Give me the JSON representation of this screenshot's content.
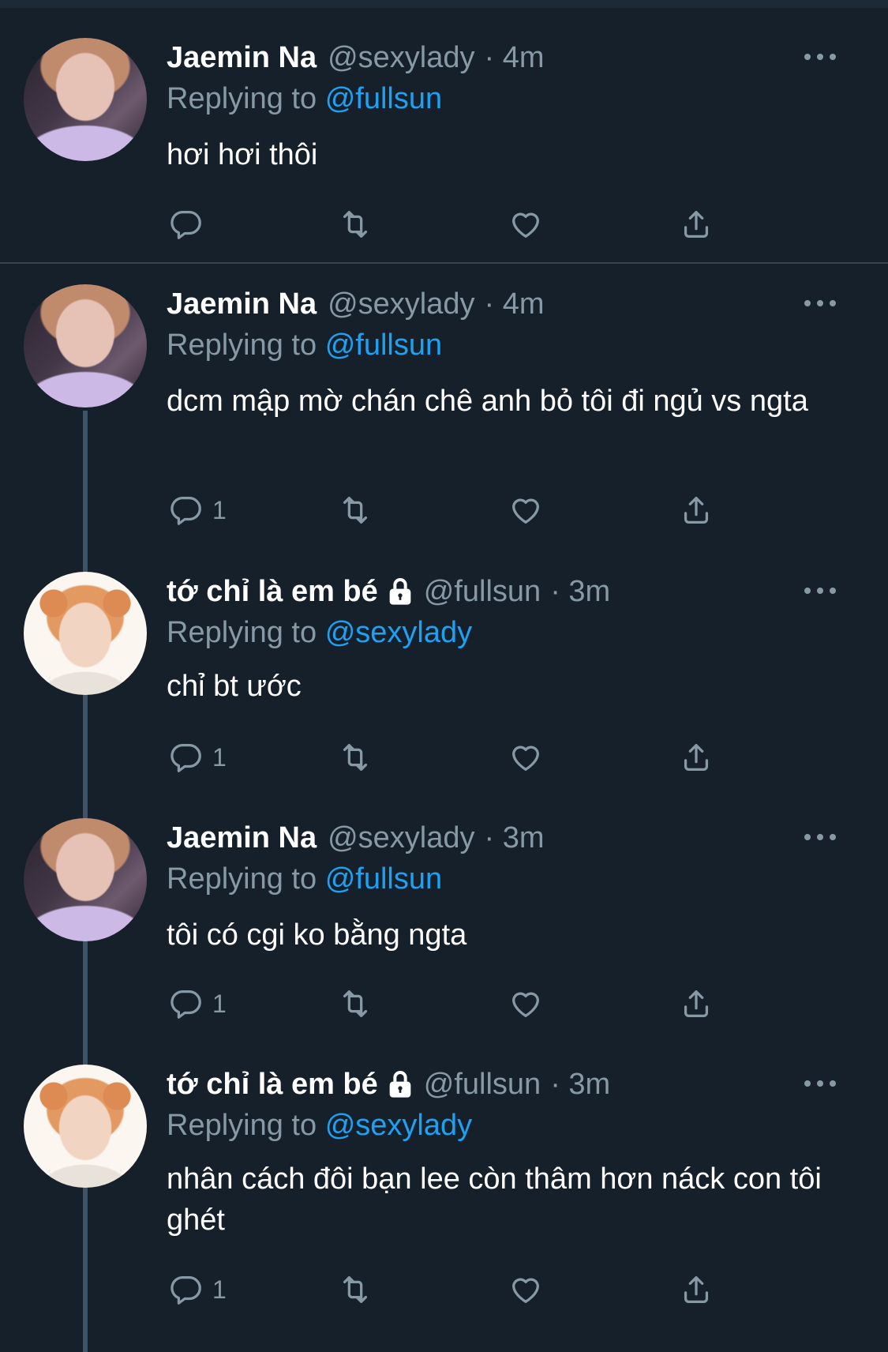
{
  "theme": {
    "background": "#15202b",
    "text": "#ffffff",
    "muted": "#8899a6",
    "link": "#1da1f2",
    "thread_line": "#3d5466"
  },
  "labels": {
    "replying_to": "Replying to"
  },
  "tweets": [
    {
      "avatar": "jaemin-avatar",
      "name": "Jaemin Na",
      "locked": false,
      "handle": "@sexylady",
      "time": "· 4m",
      "replying_to": "@fullsun",
      "text": "hơi hơi thôi",
      "reply_count": ""
    },
    {
      "avatar": "jaemin-avatar",
      "name": "Jaemin Na",
      "locked": false,
      "handle": "@sexylady",
      "time": "· 4m",
      "replying_to": "@fullsun",
      "text": "dcm mập mờ chán chê anh bỏ tôi đi ngủ vs ngta",
      "reply_count": "1"
    },
    {
      "avatar": "fullsun-avatar",
      "name": "tớ chỉ là em bé",
      "locked": true,
      "handle": "@fullsun",
      "time": "· 3m",
      "replying_to": "@sexylady",
      "text": "chỉ bt ước",
      "reply_count": "1"
    },
    {
      "avatar": "jaemin-avatar",
      "name": "Jaemin Na",
      "locked": false,
      "handle": "@sexylady",
      "time": "· 3m",
      "replying_to": "@fullsun",
      "text": "tôi có cgi ko bằng ngta",
      "reply_count": "1"
    },
    {
      "avatar": "fullsun-avatar",
      "name": "tớ chỉ là em bé",
      "locked": true,
      "handle": "@fullsun",
      "time": "· 3m",
      "replying_to": "@sexylady",
      "text": "nhân cách đôi bạn lee còn thâm hơn náck con tôi ghét",
      "reply_count": "1"
    }
  ],
  "icons": {
    "reply": "reply-icon",
    "retweet": "retweet-icon",
    "like": "like-icon",
    "share": "share-icon",
    "more": "more-icon",
    "lock": "lock-icon"
  }
}
